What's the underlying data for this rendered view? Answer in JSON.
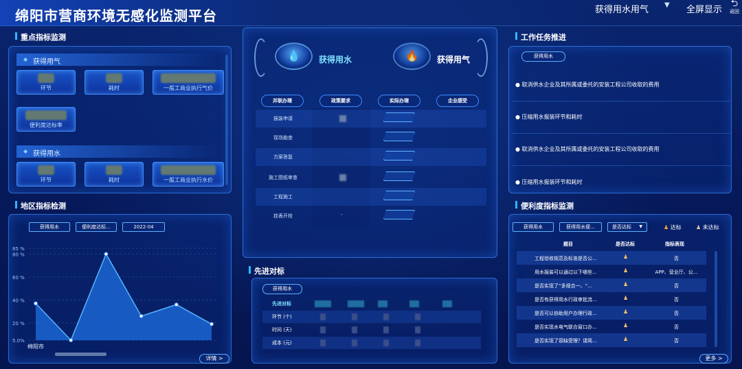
{
  "header": {
    "title": "绵阳市营商环境无感化监测平台",
    "select_value": "获得用水用气",
    "fullscreen_label": "全屏显示",
    "back_label": "返回"
  },
  "sections": {
    "key_metrics": "重点指标监测",
    "work_tasks": "工作任务推进",
    "regional": "地区指标检测",
    "convenience": "便利度指标监测",
    "advanced": "先进对标"
  },
  "key_metrics": {
    "gas": {
      "label": "获得用气",
      "items": [
        "环节",
        "耗时",
        "一般工商业执行气价",
        "便利度达标率"
      ]
    },
    "water": {
      "label": "获得用水",
      "items": [
        "环节",
        "耗时",
        "一般工商业执行水价"
      ]
    }
  },
  "center": {
    "tab_water": "获得用水",
    "tab_gas": "获得用气",
    "columns": [
      "并联办理",
      "政策要求",
      "实际办理",
      "企业感受"
    ],
    "rows": [
      {
        "name": "报装申请",
        "policy": ""
      },
      {
        "name": "现场勘查",
        "policy": ""
      },
      {
        "name": "方案答复",
        "policy": ""
      },
      {
        "name": "施工图纸审查",
        "policy": ""
      },
      {
        "name": "工程施工",
        "policy": ""
      },
      {
        "name": "挂表开栓",
        "policy": "-"
      }
    ]
  },
  "tasks": {
    "tag": "获得用水",
    "items": [
      "取消供水企业及其所属或委托的安装工程公司收取的费用",
      "压缩用水报装环节和耗时",
      "取消供水企业及其所属或委托的安装工程公司收取的费用",
      "压缩用水报装环节和耗时"
    ]
  },
  "regional": {
    "filters": [
      "获得用水",
      "便利度达标...",
      "2022-04"
    ],
    "more_label": "详情 >",
    "first_category": "绵阳市"
  },
  "chart_data": {
    "type": "area",
    "y_ticks": [
      "5.0%",
      "20 %",
      "40 %",
      "60 %",
      "80 %",
      "85 %"
    ],
    "ylim": [
      5,
      85
    ],
    "categories": [
      "绵阳市",
      "",
      "",
      "",
      "",
      ""
    ],
    "values": [
      37,
      5,
      80,
      26,
      36,
      19
    ],
    "color": "#1e6fe0"
  },
  "advanced": {
    "tag": "获得用水",
    "rows": [
      "先进对标",
      "环节 (个)",
      "时间 (天)",
      "成本 (元)"
    ]
  },
  "convenience": {
    "filters": [
      "获得用水",
      "获得用水便...",
      "是否达标"
    ],
    "legend_ok": "达标",
    "legend_fail": "未达标",
    "headers": [
      "题目",
      "是否达标",
      "指标表现"
    ],
    "rows": [
      {
        "q": "工程验收规范及标准是否公...",
        "v": "否"
      },
      {
        "q": "用水报装可以通过以下哪些...",
        "v": "APP、营业厅、公..."
      },
      {
        "q": "是否实现了“多规合一、“...",
        "v": "否"
      },
      {
        "q": "是否有获得用水行政审批流...",
        "v": "否"
      },
      {
        "q": "是否可以协助用户办理行政...",
        "v": "否"
      },
      {
        "q": "是否实现水电气联合窗口办...",
        "v": "否"
      },
      {
        "q": "是否实现了容缺受理？请简...",
        "v": "否"
      }
    ],
    "more_label": "更多 >"
  }
}
